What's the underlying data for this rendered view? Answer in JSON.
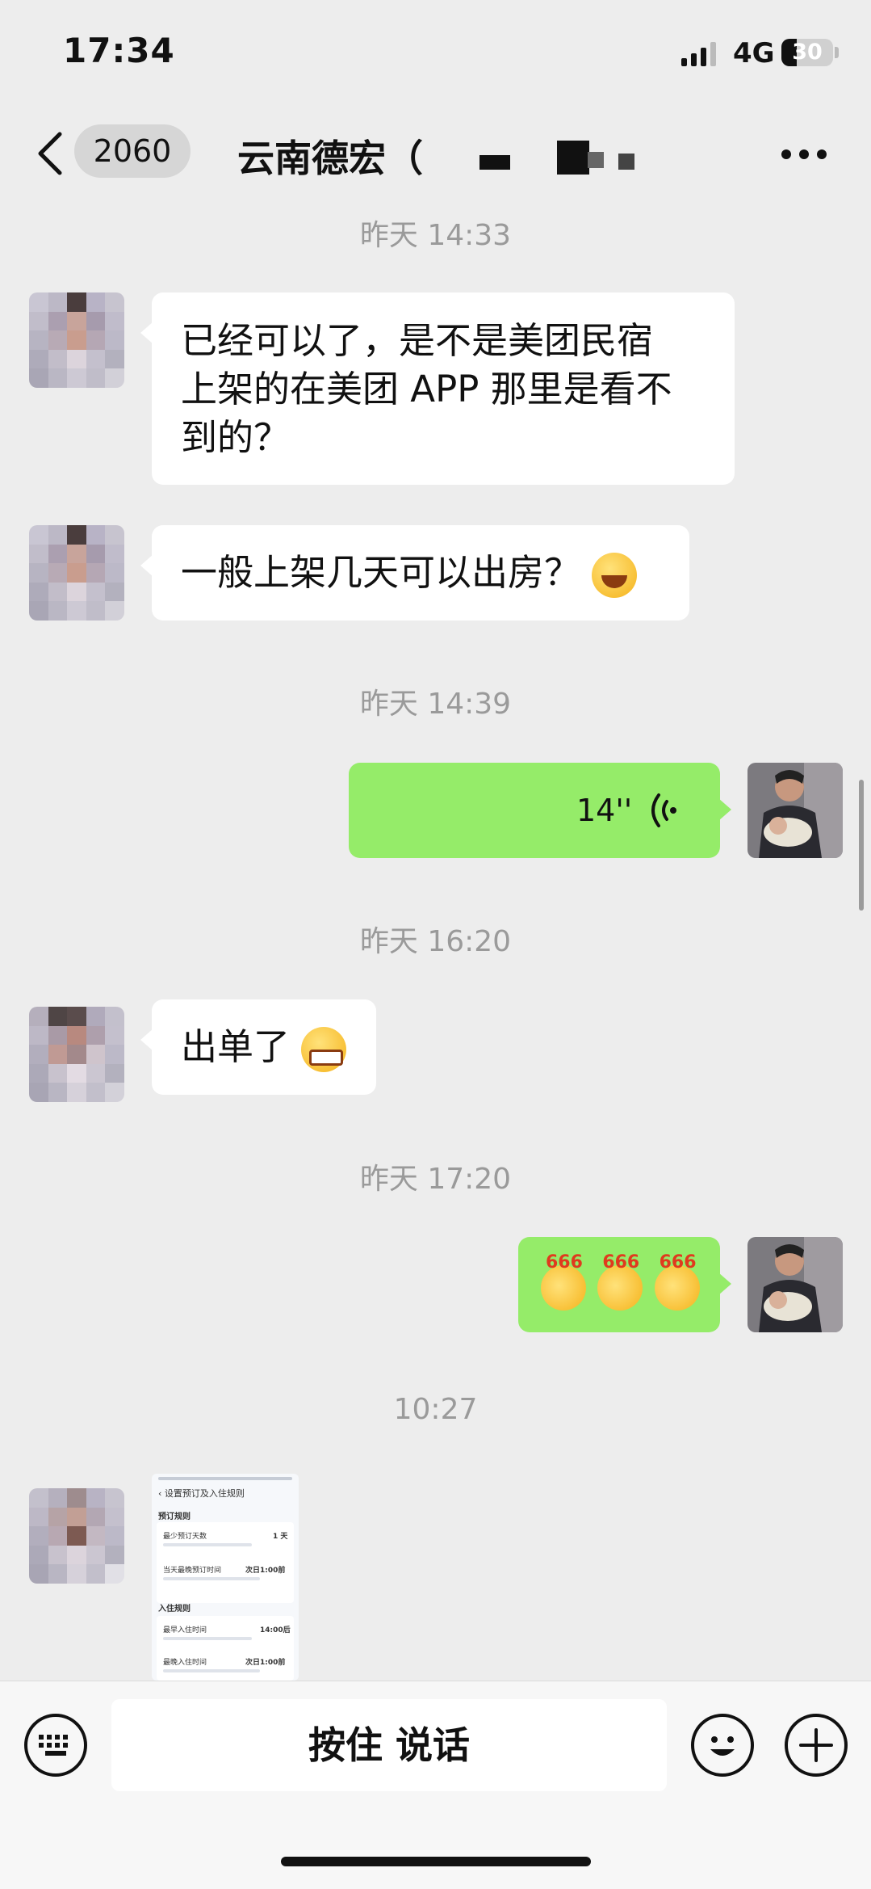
{
  "status": {
    "time": "17:34",
    "network": "4G",
    "battery": "30",
    "battery_level": 0.3,
    "signal_icon": "signal-bars-icon"
  },
  "header": {
    "unread_count": "2060",
    "title": "云南德宏（",
    "back_icon": "chevron-left-icon",
    "more_icon": "more-dots-icon"
  },
  "messages": [
    {
      "type": "timestamp",
      "text": "昨天 14:33"
    },
    {
      "type": "text",
      "direction": "in",
      "lines": [
        "已经可以了，是不是美团民宿",
        "上架的在美团 APP 那里是看不",
        "到的？"
      ]
    },
    {
      "type": "text",
      "direction": "in",
      "text": "一般上架几天可以出房？",
      "emoji": "laughing-tears-emoji"
    },
    {
      "type": "timestamp",
      "text": "昨天 14:39"
    },
    {
      "type": "voice",
      "direction": "out",
      "duration": "14''"
    },
    {
      "type": "timestamp",
      "text": "昨天 16:20"
    },
    {
      "type": "text",
      "direction": "in",
      "text": "出单了",
      "emoji": "grin-emoji"
    },
    {
      "type": "timestamp",
      "text": "昨天 17:20"
    },
    {
      "type": "sticker",
      "direction": "out",
      "count": 3,
      "label": "666"
    },
    {
      "type": "timestamp",
      "text": "10:27"
    },
    {
      "type": "image",
      "direction": "in",
      "content": {
        "header": "设置预订及入住规则",
        "section1": "预订规则",
        "row1_label": "最少预订天数",
        "row1_value": "1 天",
        "row2_label": "当天最晚预订时间",
        "row2_value": "次日1:00前",
        "section2": "入住规则",
        "row3_label": "最早入住时间",
        "row3_value": "14:00后",
        "row4_label": "最晚入住时间",
        "row4_value": "次日1:00前"
      }
    }
  ],
  "input_bar": {
    "talk_label": "按住 说话",
    "keyboard_icon": "keyboard-icon",
    "emoji_icon": "smiley-icon",
    "plus_icon": "plus-icon"
  }
}
